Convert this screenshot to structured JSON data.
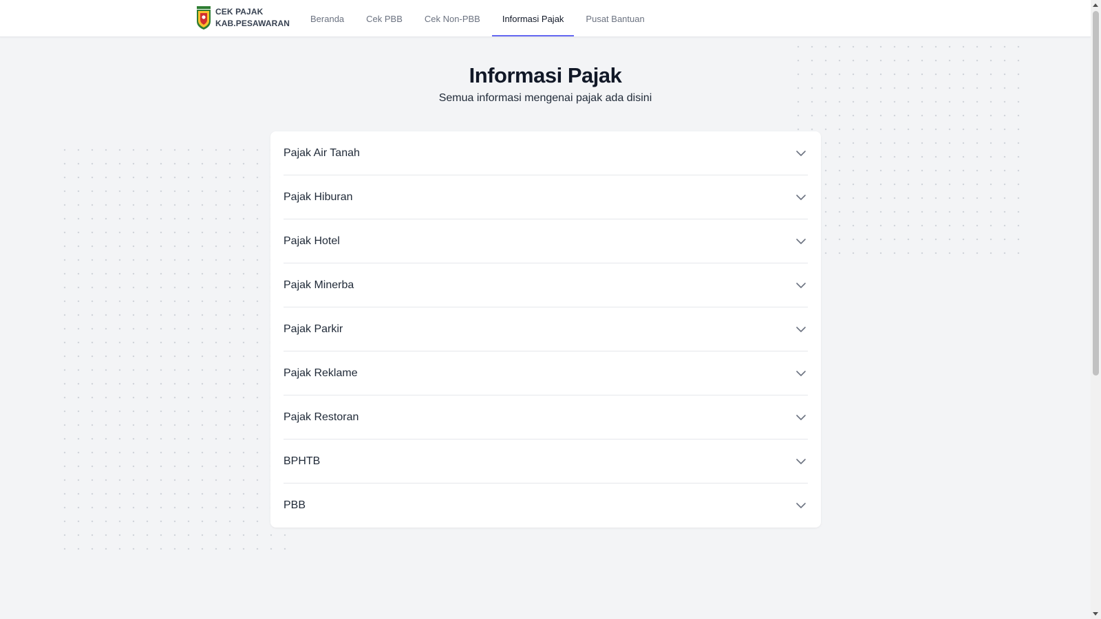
{
  "header": {
    "brand_line1": "CEK PAJAK",
    "brand_line2": "KAB.PESAWARAN",
    "nav": [
      {
        "label": "Beranda",
        "active": false
      },
      {
        "label": "Cek PBB",
        "active": false
      },
      {
        "label": "Cek Non-PBB",
        "active": false
      },
      {
        "label": "Informasi Pajak",
        "active": true
      },
      {
        "label": "Pusat Bantuan",
        "active": false
      }
    ]
  },
  "main": {
    "title": "Informasi Pajak",
    "subtitle": "Semua informasi mengenai pajak ada disini",
    "accordion": [
      {
        "label": "Pajak Air Tanah",
        "icon": "chevron-down-icon"
      },
      {
        "label": "Pajak Hiburan",
        "icon": "chevron-down-icon"
      },
      {
        "label": "Pajak Hotel",
        "icon": "chevron-down-icon"
      },
      {
        "label": "Pajak Minerba",
        "icon": "chevron-down-icon"
      },
      {
        "label": "Pajak Parkir",
        "icon": "chevron-down-icon"
      },
      {
        "label": "Pajak Reklame",
        "icon": "chevron-down-icon"
      },
      {
        "label": "Pajak Restoran",
        "icon": "chevron-down-icon"
      },
      {
        "label": "BPHTB",
        "icon": "chevron-down-icon"
      },
      {
        "label": "PBB",
        "icon": "chevron-down-icon"
      }
    ]
  },
  "colors": {
    "accent": "#6366f1",
    "background": "#f3f4f6",
    "card": "#ffffff"
  }
}
